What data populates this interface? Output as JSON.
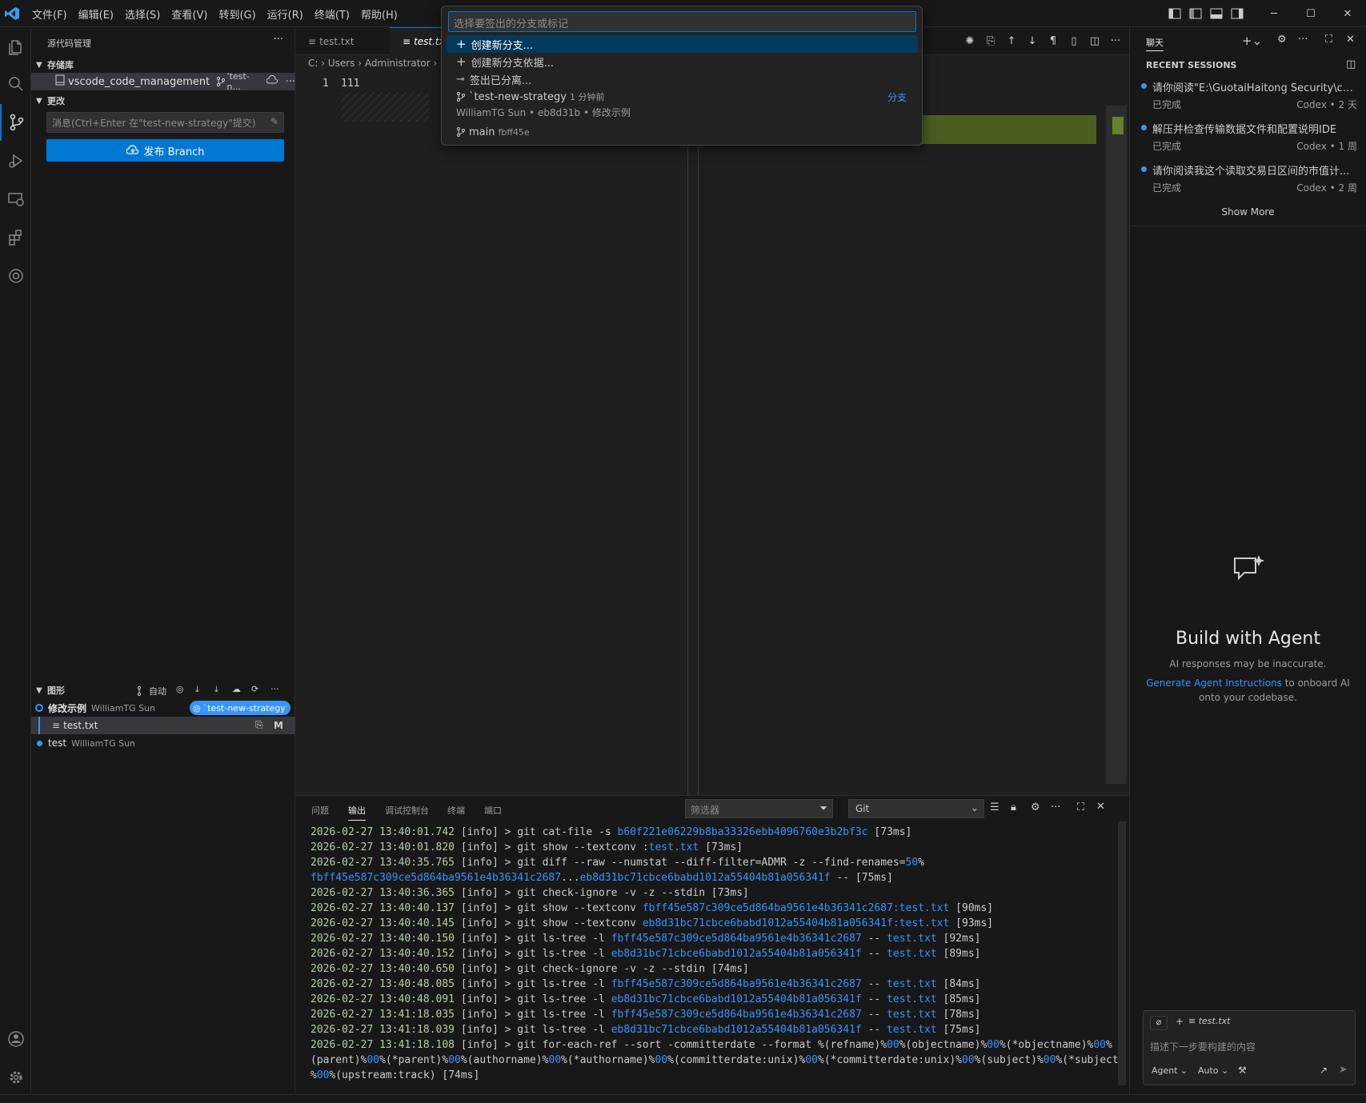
{
  "menus": [
    "文件(F)",
    "编辑(E)",
    "选择(S)",
    "查看(V)",
    "转到(G)",
    "运行(R)",
    "终端(T)",
    "帮助(H)"
  ],
  "sidebar": {
    "title": "源代码管理",
    "repos_header": "存储库",
    "repo_name": "vscode_code_management",
    "repo_branch": "'test-n...",
    "changes_header": "更改",
    "message_placeholder": "消息(Ctrl+Enter 在\"test-new-strategy\"提交)",
    "publish_label": "发布 Branch",
    "graph_header": "图形",
    "graph_auto": "自动",
    "graph": [
      {
        "title": "修改示例",
        "author": "WilliamTG Sun",
        "badge": "`test-new-strategy"
      },
      {
        "file": "test.txt",
        "status": "M"
      },
      {
        "title": "test",
        "author": "WilliamTG Sun"
      }
    ]
  },
  "editor": {
    "tabs": [
      "test.txt",
      "test.tx"
    ],
    "breadcrumb": [
      "C:",
      "Users",
      "Administrator"
    ],
    "line_number": "1",
    "line_text": "111"
  },
  "quickpick": {
    "placeholder": "选择要签出的分支或标记",
    "items": [
      {
        "label": "创建新分支...",
        "icon": "plus-icon"
      },
      {
        "label": "创建新分支依据...",
        "icon": "plus-icon"
      },
      {
        "label": "签出已分离...",
        "icon": "detach-icon"
      }
    ],
    "branch_current": {
      "name": "`test-new-strategy",
      "time": "1 分钟前",
      "author": "WilliamTG Sun",
      "hash": "eb8d31b",
      "message": "修改示例",
      "tag": "分支"
    },
    "branch_main": {
      "name": "main",
      "hash": "fbff45e"
    }
  },
  "chat": {
    "title": "聊天",
    "recent_header": "RECENT SESSIONS",
    "sessions": [
      {
        "title": "请你阅读\"E:\\GuotaiHaitong Security\\calcul...",
        "status": "已完成",
        "meta": "Codex • 2 天"
      },
      {
        "title": "解压并检查传输数据文件和配置说明IDE",
        "status": "已完成",
        "meta": "Codex • 1 周"
      },
      {
        "title": "请你阅读我这个读取交易日区间的市值计...",
        "status": "已完成",
        "meta": "Codex • 2 周"
      }
    ],
    "show_more": "Show More",
    "build_title": "Build with Agent",
    "build_sub": "AI responses may be inaccurate.",
    "link_text": "Generate Agent Instructions",
    "link_rest": " to onboard AI onto your codebase.",
    "input_file": "test.txt",
    "input_placeholder": "描述下一步要构建的内容",
    "mode": "Agent",
    "model": "Auto"
  },
  "panel": {
    "tabs": [
      "问题",
      "输出",
      "调试控制台",
      "终端",
      "端口"
    ],
    "filter_placeholder": "筛选器",
    "channel": "Git",
    "log": [
      [
        [
          "ts",
          "2026-02-27 13:40:01.742"
        ],
        [
          "t",
          " [info] > git cat-file -s "
        ],
        [
          "h",
          "b60f221e06229b8ba33326ebb4096760e3b2bf3c"
        ],
        [
          "t",
          " [73ms]"
        ]
      ],
      [
        [
          "ts",
          "2026-02-27 13:40:01.820"
        ],
        [
          "t",
          " [info] > git show --textconv :"
        ],
        [
          "h",
          "test.txt"
        ],
        [
          "t",
          " [73ms]"
        ]
      ],
      [
        [
          "ts",
          "2026-02-27 13:40:35.765"
        ],
        [
          "t",
          " [info] > git diff --raw --numstat --diff-filter=ADMR -z --find-renames="
        ],
        [
          "h",
          "50"
        ],
        [
          "t",
          "%"
        ]
      ],
      [
        [
          "h",
          "fbff45e587c309ce5d864ba9561e4b36341c2687"
        ],
        [
          "t",
          "..."
        ],
        [
          "h",
          "eb8d31bc71cbce6babd1012a55404b81a056341f"
        ],
        [
          "t",
          " -- [75ms]"
        ]
      ],
      [
        [
          "ts",
          "2026-02-27 13:40:36.365"
        ],
        [
          "t",
          " [info] > git check-ignore -v -z --stdin [73ms]"
        ]
      ],
      [
        [
          "ts",
          "2026-02-27 13:40:40.137"
        ],
        [
          "t",
          " [info] > git show --textconv "
        ],
        [
          "h",
          "fbff45e587c309ce5d864ba9561e4b36341c2687:test.txt"
        ],
        [
          "t",
          " [90ms]"
        ]
      ],
      [
        [
          "ts",
          "2026-02-27 13:40:40.145"
        ],
        [
          "t",
          " [info] > git show --textconv "
        ],
        [
          "h",
          "eb8d31bc71cbce6babd1012a55404b81a056341f:test.txt"
        ],
        [
          "t",
          " [93ms]"
        ]
      ],
      [
        [
          "ts",
          "2026-02-27 13:40:40.150"
        ],
        [
          "t",
          " [info] > git ls-tree -l "
        ],
        [
          "h",
          "fbff45e587c309ce5d864ba9561e4b36341c2687"
        ],
        [
          "t",
          " -- "
        ],
        [
          "h",
          "test.txt"
        ],
        [
          "t",
          " [92ms]"
        ]
      ],
      [
        [
          "ts",
          "2026-02-27 13:40:40.152"
        ],
        [
          "t",
          " [info] > git ls-tree -l "
        ],
        [
          "h",
          "eb8d31bc71cbce6babd1012a55404b81a056341f"
        ],
        [
          "t",
          " -- "
        ],
        [
          "h",
          "test.txt"
        ],
        [
          "t",
          " [89ms]"
        ]
      ],
      [
        [
          "ts",
          "2026-02-27 13:40:40.650"
        ],
        [
          "t",
          " [info] > git check-ignore -v -z --stdin [74ms]"
        ]
      ],
      [
        [
          "ts",
          "2026-02-27 13:40:48.085"
        ],
        [
          "t",
          " [info] > git ls-tree -l "
        ],
        [
          "h",
          "fbff45e587c309ce5d864ba9561e4b36341c2687"
        ],
        [
          "t",
          " -- "
        ],
        [
          "h",
          "test.txt"
        ],
        [
          "t",
          " [84ms]"
        ]
      ],
      [
        [
          "ts",
          "2026-02-27 13:40:48.091"
        ],
        [
          "t",
          " [info] > git ls-tree -l "
        ],
        [
          "h",
          "eb8d31bc71cbce6babd1012a55404b81a056341f"
        ],
        [
          "t",
          " -- "
        ],
        [
          "h",
          "test.txt"
        ],
        [
          "t",
          " [85ms]"
        ]
      ],
      [
        [
          "ts",
          "2026-02-27 13:41:18.035"
        ],
        [
          "t",
          " [info] > git ls-tree -l "
        ],
        [
          "h",
          "fbff45e587c309ce5d864ba9561e4b36341c2687"
        ],
        [
          "t",
          " -- "
        ],
        [
          "h",
          "test.txt"
        ],
        [
          "t",
          " [78ms]"
        ]
      ],
      [
        [
          "ts",
          "2026-02-27 13:41:18.039"
        ],
        [
          "t",
          " [info] > git ls-tree -l "
        ],
        [
          "h",
          "eb8d31bc71cbce6babd1012a55404b81a056341f"
        ],
        [
          "t",
          " -- "
        ],
        [
          "h",
          "test.txt"
        ],
        [
          "t",
          " [75ms]"
        ]
      ],
      [
        [
          "ts",
          "2026-02-27 13:41:18.108"
        ],
        [
          "t",
          " [info] > git for-each-ref --sort -committerdate --format %(refname)%"
        ],
        [
          "h",
          "00"
        ],
        [
          "t",
          "%(objectname)%"
        ],
        [
          "h",
          "00"
        ],
        [
          "t",
          "%(*objectname)%"
        ],
        [
          "h",
          "00"
        ],
        [
          "t",
          "%"
        ]
      ],
      [
        [
          "t",
          "(parent)%"
        ],
        [
          "h",
          "00"
        ],
        [
          "t",
          "%(*parent)%"
        ],
        [
          "h",
          "00"
        ],
        [
          "t",
          "%(authorname)%"
        ],
        [
          "h",
          "00"
        ],
        [
          "t",
          "%(*authorname)%"
        ],
        [
          "h",
          "00"
        ],
        [
          "t",
          "%(committerdate:unix)%"
        ],
        [
          "h",
          "00"
        ],
        [
          "t",
          "%(*committerdate:unix)%"
        ],
        [
          "h",
          "00"
        ],
        [
          "t",
          "%(subject)%"
        ],
        [
          "h",
          "00"
        ],
        [
          "t",
          "%(*subject)"
        ]
      ],
      [
        [
          "t",
          "%"
        ],
        [
          "h",
          "00"
        ],
        [
          "t",
          "%(upstream:track) [74ms]"
        ]
      ]
    ]
  },
  "colors": {
    "accent": "#0078d4",
    "added_bg": "#4b5e1f",
    "link": "#3794ff"
  }
}
